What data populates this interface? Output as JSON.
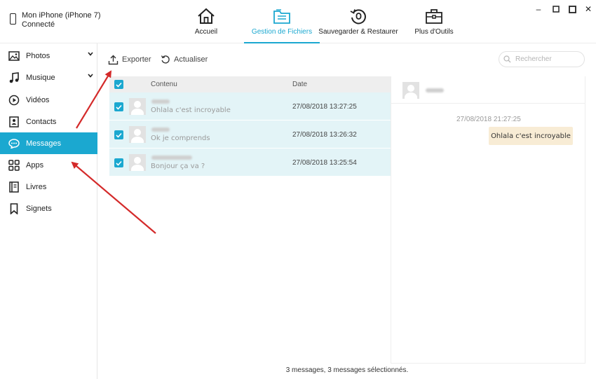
{
  "device": {
    "name": "Mon iPhone (iPhone 7)",
    "status": "Connecté"
  },
  "nav": {
    "home": "Accueil",
    "files": "Gestion de Fichiers",
    "backup": "Sauvegarder & Restaurer",
    "tools": "Plus d'Outils",
    "active": "files"
  },
  "window": {
    "minimize": "–",
    "maximize": "□",
    "close": "✕"
  },
  "sidebar": {
    "items": [
      {
        "label": "Photos",
        "icon": "image-icon",
        "expandable": true
      },
      {
        "label": "Musique",
        "icon": "music-note-icon",
        "expandable": true
      },
      {
        "label": "Vidéos",
        "icon": "play-circle-icon",
        "expandable": false
      },
      {
        "label": "Contacts",
        "icon": "contact-card-icon",
        "expandable": false
      },
      {
        "label": "Messages",
        "icon": "chat-bubble-icon",
        "expandable": false,
        "active": true
      },
      {
        "label": "Apps",
        "icon": "apps-grid-icon",
        "expandable": false
      },
      {
        "label": "Livres",
        "icon": "book-icon",
        "expandable": false
      },
      {
        "label": "Signets",
        "icon": "bookmark-icon",
        "expandable": false
      }
    ]
  },
  "toolbar": {
    "export_label": "Exporter",
    "refresh_label": "Actualiser"
  },
  "search": {
    "placeholder": "Rechercher"
  },
  "table": {
    "headers": {
      "content": "Contenu",
      "date": "Date"
    },
    "rows": [
      {
        "preview": "Ohlala c'est incroyable",
        "date": "27/08/2018 13:27:25",
        "checked": true
      },
      {
        "preview": "Ok je comprends",
        "date": "27/08/2018 13:26:32",
        "checked": true
      },
      {
        "preview": "Bonjour ça va ?",
        "date": "27/08/2018 13:25:54",
        "checked": true
      }
    ]
  },
  "detail": {
    "timestamp": "27/08/2018 21:27:25",
    "message": "Ohlala c'est incroyable"
  },
  "status": {
    "text": "3 messages, 3 messages sélectionnés."
  },
  "colors": {
    "accent": "#1ba8d0",
    "row_selected": "#e3f4f7",
    "bubble": "#f8ecd5",
    "annotation_arrow": "#d42a2a"
  }
}
